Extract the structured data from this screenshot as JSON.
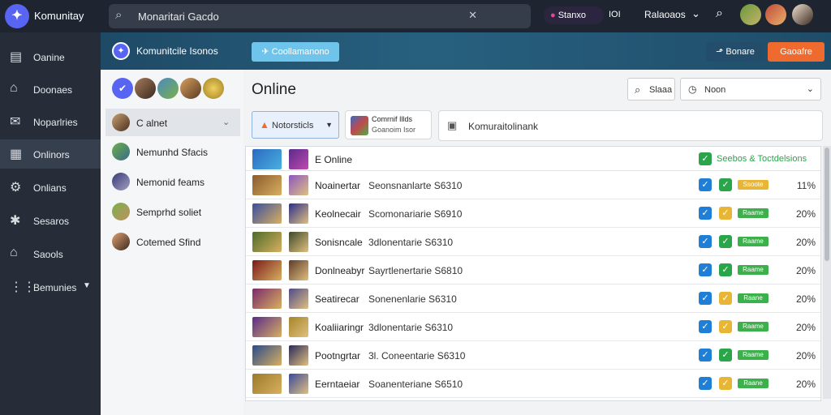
{
  "app": {
    "name": "Komunitay",
    "logo_glyph": "✦"
  },
  "topbar": {
    "search_text": "Monaritari Gacdo",
    "search_icon": "search-icon",
    "pill_label": "Stanxo",
    "pill_count": "IOI",
    "menu_label": "Ralaoaos"
  },
  "sidebar": {
    "items": [
      {
        "label": "Oanine",
        "icon": "▤"
      },
      {
        "label": "Doonaes",
        "icon": "⌂"
      },
      {
        "label": "Noparlries",
        "icon": "✉"
      },
      {
        "label": "Onlinors",
        "icon": "▦"
      },
      {
        "label": "Onlians",
        "icon": "⚙"
      },
      {
        "label": "Sesaros",
        "icon": "✱"
      },
      {
        "label": "Saools",
        "icon": "⌂"
      },
      {
        "label": "Bemunies",
        "icon": "⋮⋮"
      }
    ]
  },
  "banner": {
    "title": "Komunitcile Isonos",
    "button_primary": "Coollamanono",
    "button_secondary": "Bonare",
    "button_orange": "Gaoafre"
  },
  "leftpanel": {
    "channels": [
      {
        "label": "C alnet"
      },
      {
        "label": "Nemunhd Sfacis"
      },
      {
        "label": "Nemonid feams"
      },
      {
        "label": "Semprhd soliet"
      },
      {
        "label": "Cotemed Sfind"
      }
    ]
  },
  "main": {
    "title": "Online",
    "search_button": "Slaaa",
    "select_value": "Noon",
    "filter_label": "Notorsticls",
    "card_line1": "Comrnif Illds",
    "card_line2": "Goanoim Isor",
    "input_value": "Komuraitolinank"
  },
  "table": {
    "header_label": "E Online",
    "header_right": "Seebos & Toctdelsions",
    "rows": [
      {
        "name": "Noainertar",
        "desc": "Seonsnanlarte S6310",
        "tag": "Ssoote",
        "pct": "11%",
        "c1": "#8a5a2e",
        "c2": "#8a57c0",
        "tagcolor": "#e8b636",
        "cb2": "#2aa54a"
      },
      {
        "name": "Keolnecair",
        "desc": "Scomonariarie S6910",
        "tag": "Raame",
        "pct": "20%",
        "c1": "#3a4fa0",
        "c2": "#2d2f8a",
        "tagcolor": "#3cb04a",
        "cb2": "#e8b636"
      },
      {
        "name": "Sonisncale",
        "desc": "3dlonentarie S6310",
        "tag": "Raame",
        "pct": "20%",
        "c1": "#4c6b2a",
        "c2": "#3d4a2a",
        "tagcolor": "#3cb04a",
        "cb2": "#2aa54a"
      },
      {
        "name": "Donlneabyr",
        "desc": "Sayrtlenertarie S6810",
        "tag": "Raame",
        "pct": "20%",
        "c1": "#7a1a1a",
        "c2": "#5e3a2a",
        "tagcolor": "#3cb04a",
        "cb2": "#2aa54a"
      },
      {
        "name": "Seatirecar",
        "desc": "Sonenenlarie S6310",
        "tag": "Raane",
        "pct": "20%",
        "c1": "#7a2a6a",
        "c2": "#4e4a8a",
        "tagcolor": "#3cb04a",
        "cb2": "#e8b636"
      },
      {
        "name": "Koaliiaringr",
        "desc": "3dlonentarie S6310",
        "tag": "Raame",
        "pct": "20%",
        "c1": "#5a2a8a",
        "c2": "#a6852a",
        "tagcolor": "#3cb04a",
        "cb2": "#e8b636"
      },
      {
        "name": "Pootngrtar",
        "desc": "3l. Coneentarie S6310",
        "tag": "Raame",
        "pct": "20%",
        "c1": "#2a4a8a",
        "c2": "#2a2a5a",
        "tagcolor": "#3cb04a",
        "cb2": "#2aa54a"
      },
      {
        "name": "Eerntaeiar",
        "desc": "Soanenteriane S6510",
        "tag": "Raane",
        "pct": "20%",
        "c1": "#9a7a2a",
        "c2": "#3a4a9a",
        "tagcolor": "#3cb04a",
        "cb2": "#e8b636"
      }
    ]
  },
  "colors": {
    "accent": "#5865f2",
    "orange": "#ee6a2e",
    "check_blue": "#1f7fd6",
    "check_green": "#2aa54a",
    "tag_yellow": "#e8b636"
  }
}
